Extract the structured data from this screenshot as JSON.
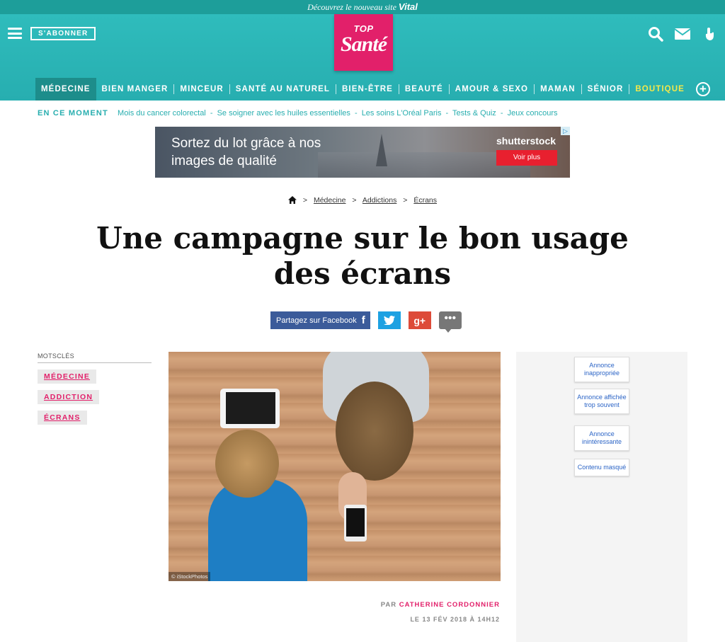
{
  "promo": {
    "text": "Découvrez le nouveau site",
    "brand": "Vital"
  },
  "header": {
    "subscribe_label": "S'ABONNER",
    "logo_top": "TOP",
    "logo_main": "Santé"
  },
  "nav": {
    "items": [
      "MÉDECINE",
      "BIEN MANGER",
      "MINCEUR",
      "SANTÉ AU NATUREL",
      "BIEN-ÊTRE",
      "BEAUTÉ",
      "AMOUR & SEXO",
      "MAMAN",
      "SÉNIOR",
      "BOUTIQUE"
    ],
    "plus_label": "+"
  },
  "trending": {
    "label": "EN CE MOMENT",
    "topics": [
      "Mois du cancer colorectal",
      "Se soigner avec les huiles essentielles",
      "Les soins L'Oréal Paris",
      "Tests & Quiz",
      "Jeux concours"
    ],
    "separator": "-"
  },
  "ad": {
    "line1": "Sortez du lot grâce à nos",
    "line2": "images de qualité",
    "brand": "shutterstock",
    "button": "Voir plus",
    "adchoice": "▷"
  },
  "breadcrumb": {
    "items": [
      "Médecine",
      "Addictions",
      "Écrans"
    ],
    "sep": ">"
  },
  "article": {
    "title": "Une campagne sur le bon usage des écrans",
    "photo_credit": "© iStockPhotos",
    "byline_prefix": "PAR",
    "author": "CATHERINE CORDONNIER",
    "date": "LE 13 FÉV 2018 À 14H12"
  },
  "share": {
    "facebook_label": "Partagez sur Facebook",
    "facebook_icon": "f",
    "google_icon": "g+",
    "comment_icon": "•••"
  },
  "keywords": {
    "heading": "MOTSCLÉS",
    "tags": [
      "MÉDECINE",
      "ADDICTION",
      "ÉCRANS"
    ]
  },
  "ad_feedback": {
    "options": [
      "Annonce inappropriée",
      "Annonce affichée trop souvent",
      "Annonce inintéressante",
      "Contenu masqué"
    ]
  },
  "colors": {
    "teal": "#2fbcbc",
    "pink": "#e2206a",
    "boutique": "#f4e84a",
    "facebook": "#3b5b9a",
    "twitter": "#1da1e2",
    "google": "#dd4b39"
  }
}
